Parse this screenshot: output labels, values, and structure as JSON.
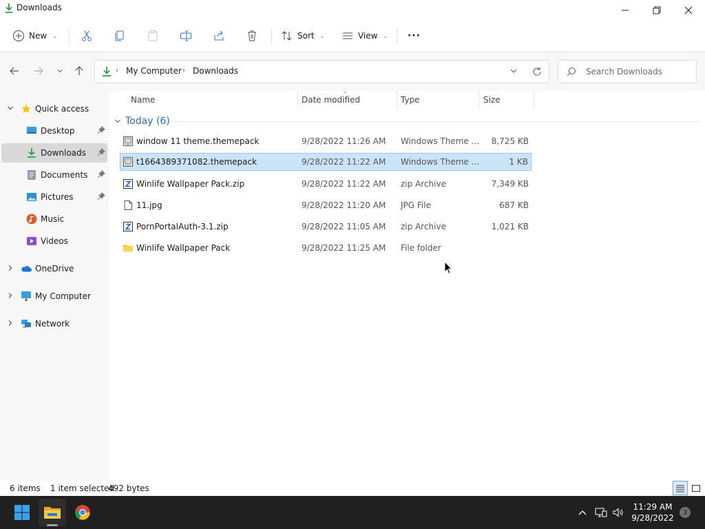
{
  "window": {
    "title": "Downloads"
  },
  "toolbar": {
    "new_label": "New",
    "sort_label": "Sort",
    "view_label": "View",
    "more_label": "···"
  },
  "address": {
    "crumbs": [
      "My Computer",
      "Downloads"
    ],
    "search_placeholder": "Search Downloads"
  },
  "sidebar": {
    "items": [
      {
        "label": "Quick access",
        "icon": "star-icon"
      },
      {
        "label": "Desktop",
        "icon": "desktop-icon"
      },
      {
        "label": "Downloads",
        "icon": "download-icon"
      },
      {
        "label": "Documents",
        "icon": "document-icon"
      },
      {
        "label": "Pictures",
        "icon": "pictures-icon"
      },
      {
        "label": "Music",
        "icon": "music-icon"
      },
      {
        "label": "Videos",
        "icon": "videos-icon"
      },
      {
        "label": "OneDrive",
        "icon": "cloud-icon"
      },
      {
        "label": "My Computer",
        "icon": "computer-icon"
      },
      {
        "label": "Network",
        "icon": "network-icon"
      }
    ]
  },
  "columns": {
    "name": "Name",
    "date": "Date modified",
    "type": "Type",
    "size": "Size"
  },
  "group": {
    "label": "Today (6)"
  },
  "files": [
    {
      "name": "window 11 theme.themepack",
      "date": "9/28/2022 11:26 AM",
      "type": "Windows Theme ...",
      "size": "8,725 KB",
      "icon": "themepack-icon"
    },
    {
      "name": "t1664389371082.themepack",
      "date": "9/28/2022 11:22 AM",
      "type": "Windows Theme ...",
      "size": "1 KB",
      "icon": "themepack-icon"
    },
    {
      "name": "Winlife Wallpaper Pack.zip",
      "date": "9/28/2022 11:22 AM",
      "type": "zip Archive",
      "size": "7,349 KB",
      "icon": "zip-icon"
    },
    {
      "name": "11.jpg",
      "date": "9/28/2022 11:20 AM",
      "type": "JPG File",
      "size": "687 KB",
      "icon": "image-file-icon"
    },
    {
      "name": "PornPortalAuth-3.1.zip",
      "date": "9/28/2022 11:05 AM",
      "type": "zip Archive",
      "size": "1,021 KB",
      "icon": "zip-icon"
    },
    {
      "name": "Winlife Wallpaper Pack",
      "date": "9/28/2022 11:25 AM",
      "type": "File folder",
      "size": "",
      "icon": "folder-icon"
    }
  ],
  "status": {
    "count": "6 items",
    "selection": "1 item selected",
    "bytes": "492 bytes"
  },
  "taskbar": {
    "time": "11:29 AM",
    "date": "9/28/2022",
    "notifications": "3"
  },
  "colors": {
    "accent": "#0067c0",
    "selection": "#cce4f7",
    "folder": "#f4c542",
    "download": "#2e9d4e"
  }
}
